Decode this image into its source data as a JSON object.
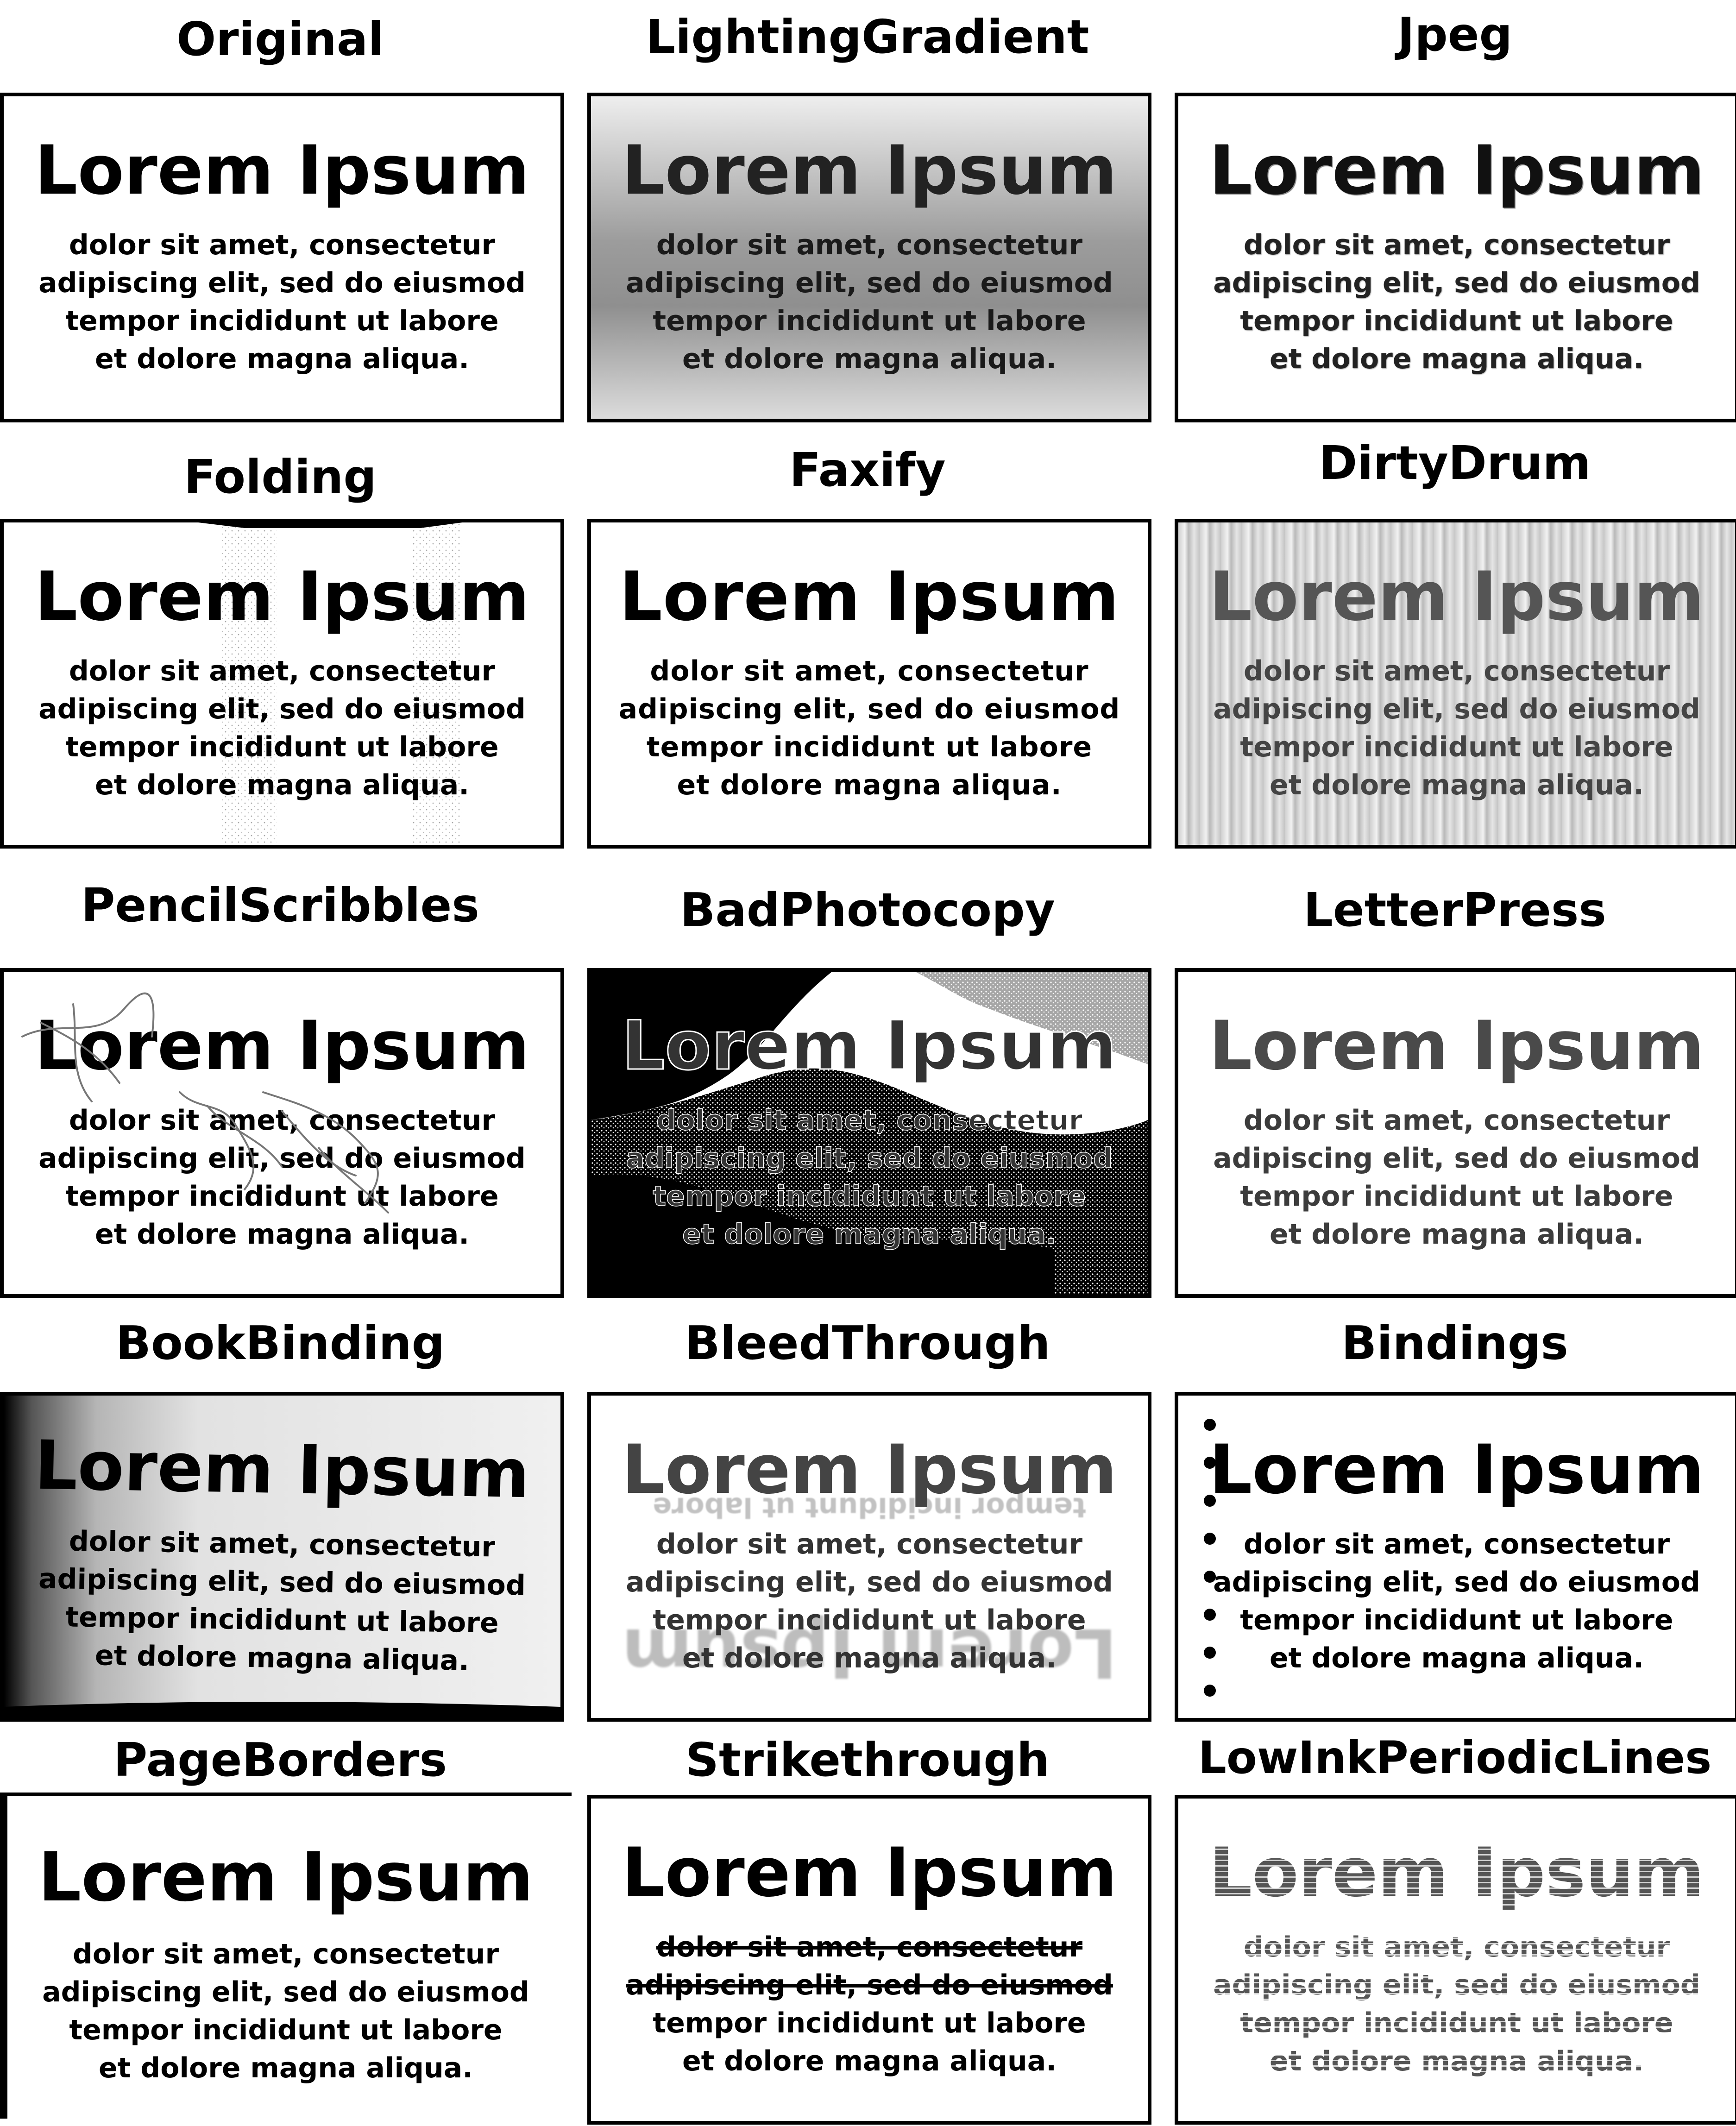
{
  "sample": {
    "title": "Lorem Ipsum",
    "lines": [
      "dolor sit amet, consectetur",
      "adipiscing elit, sed do eiusmod",
      "tempor incididunt ut labore",
      "et dolore magna aliqua."
    ]
  },
  "panels": [
    {
      "label": "Original"
    },
    {
      "label": "LightingGradient"
    },
    {
      "label": "Jpeg"
    },
    {
      "label": "Folding"
    },
    {
      "label": "Faxify"
    },
    {
      "label": "DirtyDrum"
    },
    {
      "label": "PencilScribbles"
    },
    {
      "label": "BadPhotocopy"
    },
    {
      "label": "LetterPress"
    },
    {
      "label": "BookBinding"
    },
    {
      "label": "BleedThrough"
    },
    {
      "label": "Bindings"
    },
    {
      "label": "PageBorders"
    },
    {
      "label": "Strikethrough"
    },
    {
      "label": "LowInkPeriodicLines"
    }
  ],
  "colors": {
    "ink": "#000000",
    "paper": "#ffffff",
    "faded_ink": "#555555"
  }
}
